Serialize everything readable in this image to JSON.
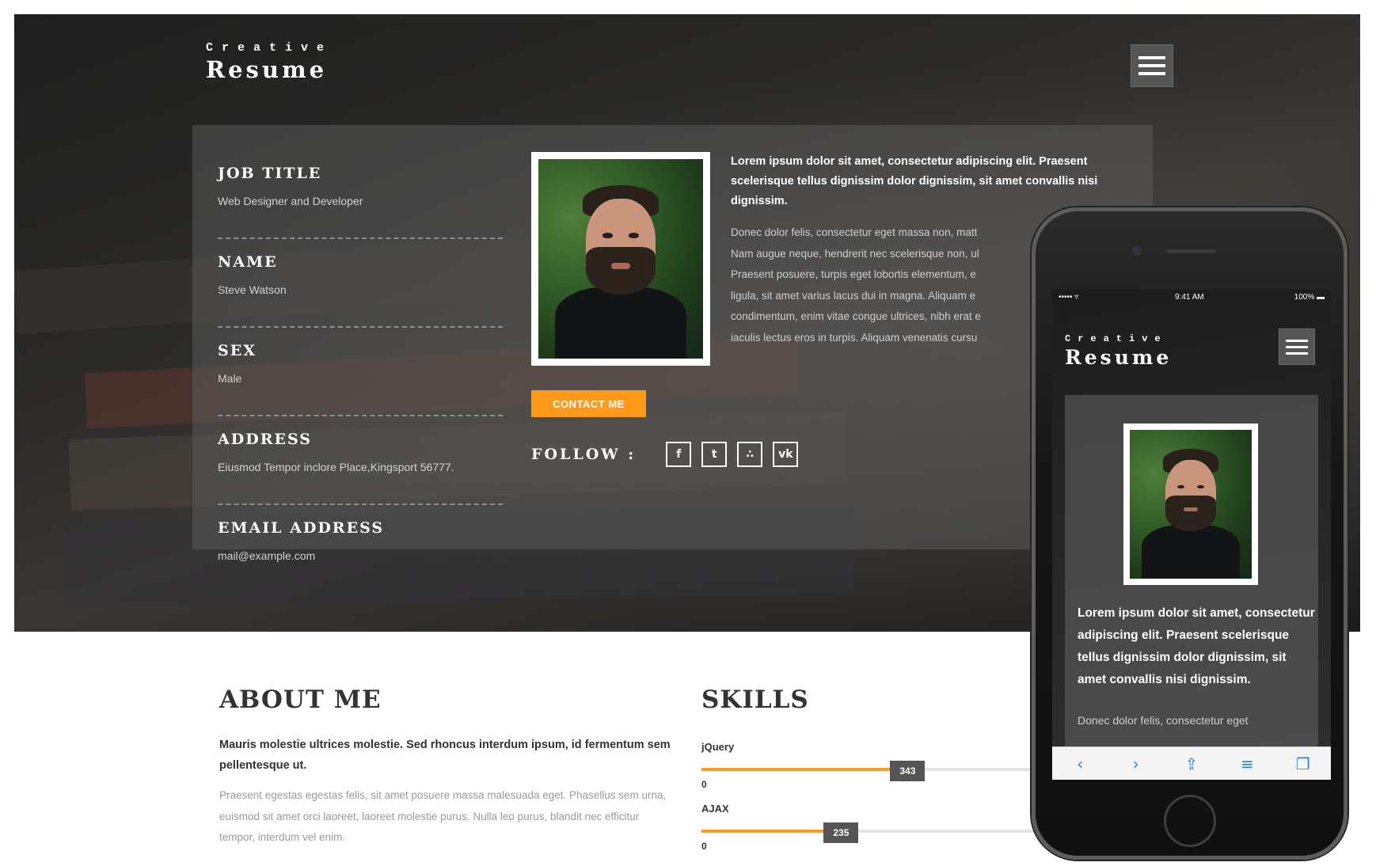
{
  "brand": {
    "top": "Creative",
    "main": "Resume"
  },
  "info": [
    {
      "label": "JOB TITLE",
      "value": "Web Designer and Developer"
    },
    {
      "label": "NAME",
      "value": "Steve Watson"
    },
    {
      "label": "SEX",
      "value": "Male"
    },
    {
      "label": "ADDRESS",
      "value": "Eiusmod Tempor inclore Place,Kingsport 56777."
    },
    {
      "label": "EMAIL ADDRESS",
      "value": "mail@example.com"
    }
  ],
  "contact_label": "CONTACT ME",
  "follow_label": "FOLLOW :",
  "social": [
    {
      "icon": "facebook-icon",
      "glyph": "f"
    },
    {
      "icon": "twitter-icon",
      "glyph": "t"
    },
    {
      "icon": "rss-icon",
      "glyph": "∴"
    },
    {
      "icon": "vk-icon",
      "glyph": "vk"
    }
  ],
  "intro": {
    "lead": "Lorem ipsum dolor sit amet, consectetur adipiscing elit. Praesent scelerisque tellus dignissim dolor dignissim, sit amet convallis nisi dignissim.",
    "body": [
      "Donec dolor felis, consectetur eget massa non, matt",
      "Nam augue neque, hendrerit nec scelerisque non, ul",
      "Praesent posuere, turpis eget lobortis elementum, e",
      "ligula, sit amet varius lacus dui in magna. Aliquam e",
      "condimentum, enim vitae congue ultrices, nibh erat e",
      "iaculis lectus eros in turpis. Aliquam venenatis cursu"
    ]
  },
  "about": {
    "title": "ABOUT ME",
    "lead": "Mauris molestie ultrices molestie. Sed rhoncus interdum ipsum, id fermentum sem pellentesque ut.",
    "body": "Praesent egestas egestas felis, sit amet posuere massa malesuada eget. Phasellus sem urna, euismod sit amet orci laoreet, laoreet molestie purus. Nulla leo purus, blandit nec efficitur tempor, interdum vel enim."
  },
  "skills": {
    "title": "SKILLS",
    "items": [
      {
        "name": "jQuery",
        "badge": "343",
        "level": 0.62,
        "zero": "0"
      },
      {
        "name": "AJAX",
        "badge": "235",
        "level": 0.42,
        "zero": "0"
      }
    ]
  },
  "phone": {
    "status_left": "••••• ▿",
    "status_time": "9:41 AM",
    "status_right": "100% ▬",
    "brand_top": "Creative",
    "brand_main": "Resume",
    "lead": "Lorem ipsum dolor sit amet, consectetur adipiscing elit. Praesent scelerisque tellus dignissim dolor dignissim, sit amet convallis nisi dignissim.",
    "body": "Donec dolor felis, consectetur eget",
    "toolbar": [
      {
        "name": "back-icon",
        "glyph": "‹"
      },
      {
        "name": "forward-icon",
        "glyph": "›"
      },
      {
        "name": "share-icon",
        "glyph": "⇪"
      },
      {
        "name": "bookmarks-icon",
        "glyph": "≡"
      },
      {
        "name": "tabs-icon",
        "glyph": "❐"
      }
    ]
  },
  "colors": {
    "accent": "#ff9a1a",
    "badge": "#555555",
    "heading": "#333333"
  }
}
